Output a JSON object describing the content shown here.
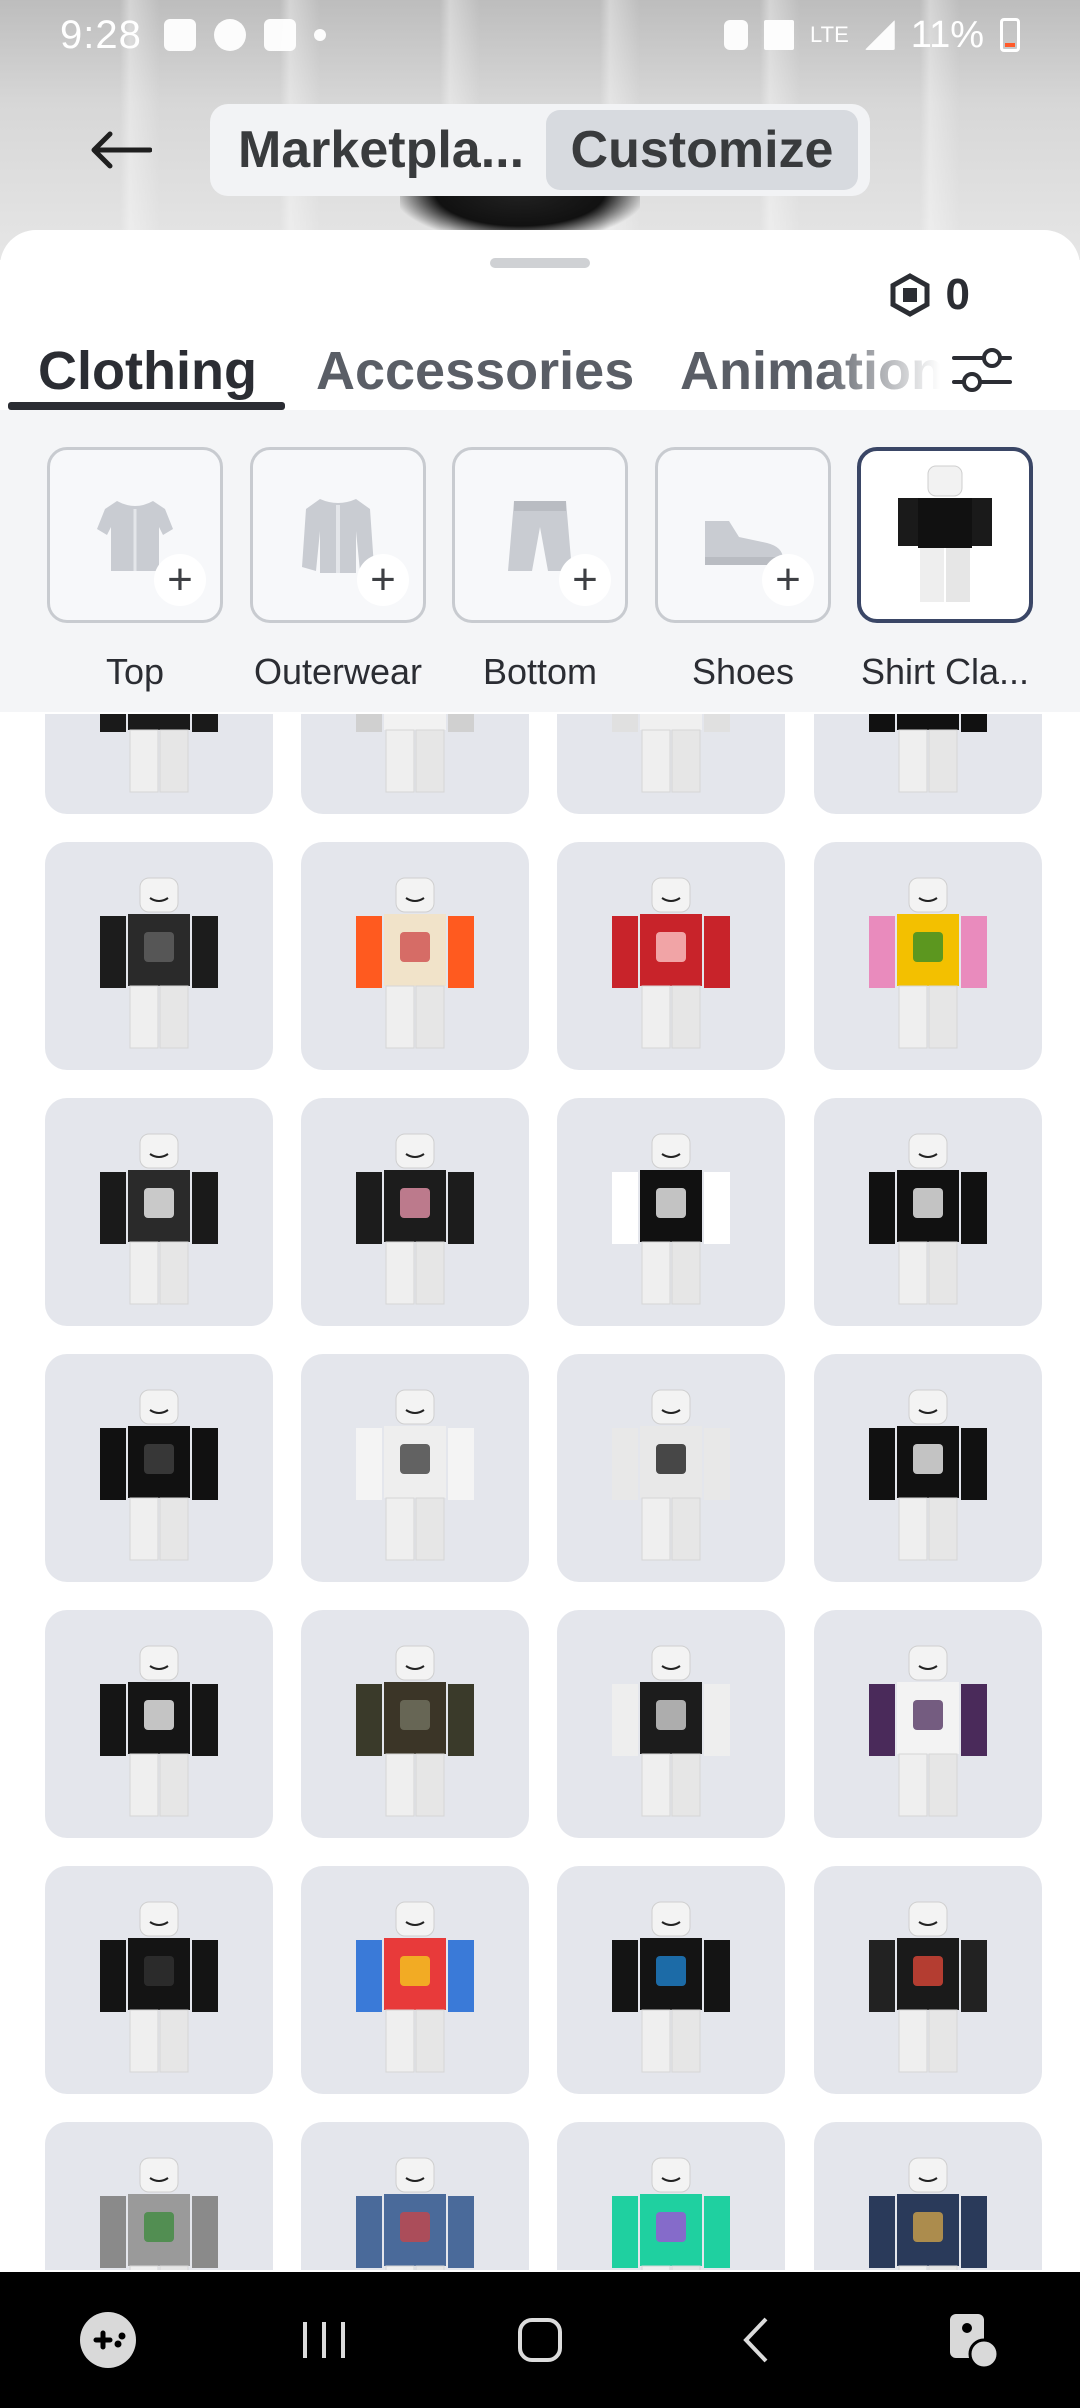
{
  "status_bar": {
    "time": "9:28",
    "battery_text": "11%",
    "network": "LTE"
  },
  "header": {
    "back_icon": "arrow-left-icon",
    "segments": [
      {
        "label": "Marketpla...",
        "active": false
      },
      {
        "label": "Customize",
        "active": true
      }
    ]
  },
  "wallet": {
    "robux_icon": "robux-icon",
    "balance": "0"
  },
  "tabs": [
    {
      "label": "Clothing",
      "active": true
    },
    {
      "label": "Accessories",
      "active": false
    },
    {
      "label": "Animation",
      "active": false
    }
  ],
  "filter_icon": "sliders-filter-icon",
  "categories": [
    {
      "label": "Top",
      "icon": "shirt-icon"
    },
    {
      "label": "Outerwear",
      "icon": "jacket-icon"
    },
    {
      "label": "Bottom",
      "icon": "pants-icon"
    },
    {
      "label": "Shoes",
      "icon": "shoe-icon"
    },
    {
      "label": "Shirt Cla...",
      "icon": "avatar-thumbnail",
      "selected": true
    }
  ],
  "items": [
    {
      "torso": "#1a1a1a",
      "arms": "#1a1a1a",
      "print": "#cccccc"
    },
    {
      "torso": "#f2f2f2",
      "arms": "#d0d0d0",
      "print": "#222222"
    },
    {
      "torso": "#f0f0f0",
      "arms": "#e0e0e0",
      "print": "#555555"
    },
    {
      "torso": "#111111",
      "arms": "#111111",
      "print": "#ffffff"
    },
    {
      "torso": "#2a2a2a",
      "arms": "#1c1c1c",
      "print": "#666666"
    },
    {
      "torso": "#f1e3c9",
      "arms": "#ff5a1f",
      "print": "#c44"
    },
    {
      "torso": "#c8232a",
      "arms": "#c8232a",
      "print": "#ffd0d0"
    },
    {
      "torso": "#f3c000",
      "arms": "#e98bbd",
      "print": "#2a8a2a"
    },
    {
      "torso": "#2a2a2a",
      "arms": "#1a1a1a",
      "print": "#ffffff"
    },
    {
      "torso": "#1c1c1c",
      "arms": "#1c1c1c",
      "print": "#f19ab2"
    },
    {
      "torso": "#111111",
      "arms": "#ffffff",
      "print": "#ffffff"
    },
    {
      "torso": "#111111",
      "arms": "#111111",
      "print": "#ffffff"
    },
    {
      "torso": "#111111",
      "arms": "#111111",
      "print": "#444444"
    },
    {
      "torso": "#eeeeee",
      "arms": "#f4f4f4",
      "print": "#333333"
    },
    {
      "torso": "#e8e8e8",
      "arms": "#e8e8e8",
      "print": "#111111"
    },
    {
      "torso": "#111111",
      "arms": "#111111",
      "print": "#ffffff"
    },
    {
      "torso": "#151515",
      "arms": "#151515",
      "print": "#ffffff"
    },
    {
      "torso": "#3b3527",
      "arms": "#3a3a2a",
      "print": "#777766"
    },
    {
      "torso": "#1c1c1c",
      "arms": "#eeeeee",
      "print": "#dddddd"
    },
    {
      "torso": "#f3f3f3",
      "arms": "#4a2a5a",
      "print": "#4a2a5a"
    },
    {
      "torso": "#141414",
      "arms": "#141414",
      "print": "#333333"
    },
    {
      "torso": "#e83a3a",
      "arms": "#3a7ad8",
      "print": "#f6d21e"
    },
    {
      "torso": "#141414",
      "arms": "#141414",
      "print": "#1f88d8"
    },
    {
      "torso": "#1a1a1a",
      "arms": "#222222",
      "print": "#e84a3a"
    },
    {
      "torso": "#9a9a9a",
      "arms": "#8a8a8a",
      "print": "#3a8a3a"
    },
    {
      "torso": "#4a6a9a",
      "arms": "#4a6a9a",
      "print": "#c44"
    },
    {
      "torso": "#1fd0a0",
      "arms": "#1fd0a0",
      "print": "#a84ad8"
    },
    {
      "torso": "#2a3a5a",
      "arms": "#2a3a5a",
      "print": "#d8a84a"
    }
  ],
  "nav": [
    {
      "icon": "gamepad-icon"
    },
    {
      "icon": "recent-apps-icon"
    },
    {
      "icon": "home-icon"
    },
    {
      "icon": "back-icon"
    },
    {
      "icon": "accessibility-icon"
    }
  ]
}
